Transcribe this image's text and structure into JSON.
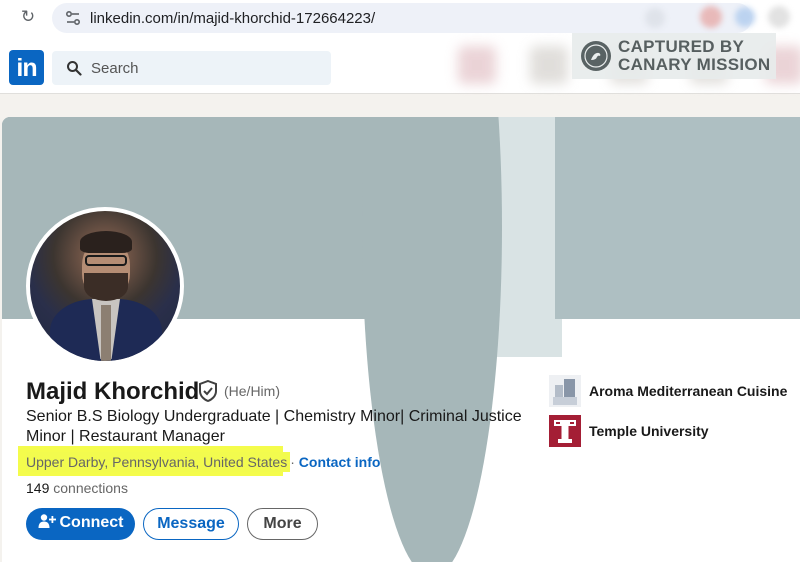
{
  "browser": {
    "url": "linkedin.com/in/majid-khorchid-172664223/"
  },
  "nav": {
    "logo": "in",
    "search_placeholder": "Search"
  },
  "banner": {
    "watermark_line1": "CAPTURED BY",
    "watermark_line2": "CANARY MISSION"
  },
  "profile": {
    "name": "Majid Khorchid",
    "pronouns": "(He/Him)",
    "headline": "Senior B.S Biology Undergraduate | Chemistry Minor| Criminal Justice Minor | Restaurant Manager",
    "location": "Upper Darby, Pennsylvania, United States",
    "separator": "·",
    "contact_info": "Contact info",
    "connections_count": "149",
    "connections_label": "connections"
  },
  "actions": {
    "connect": "Connect",
    "message": "Message",
    "more": "More"
  },
  "organizations": [
    {
      "label": "Aroma Mediterranean Cuisine"
    },
    {
      "label": "Temple University"
    }
  ],
  "colors": {
    "linkedin_blue": "#0a66c2",
    "highlight": "#f4fc4c",
    "temple_red": "#a41e35"
  }
}
